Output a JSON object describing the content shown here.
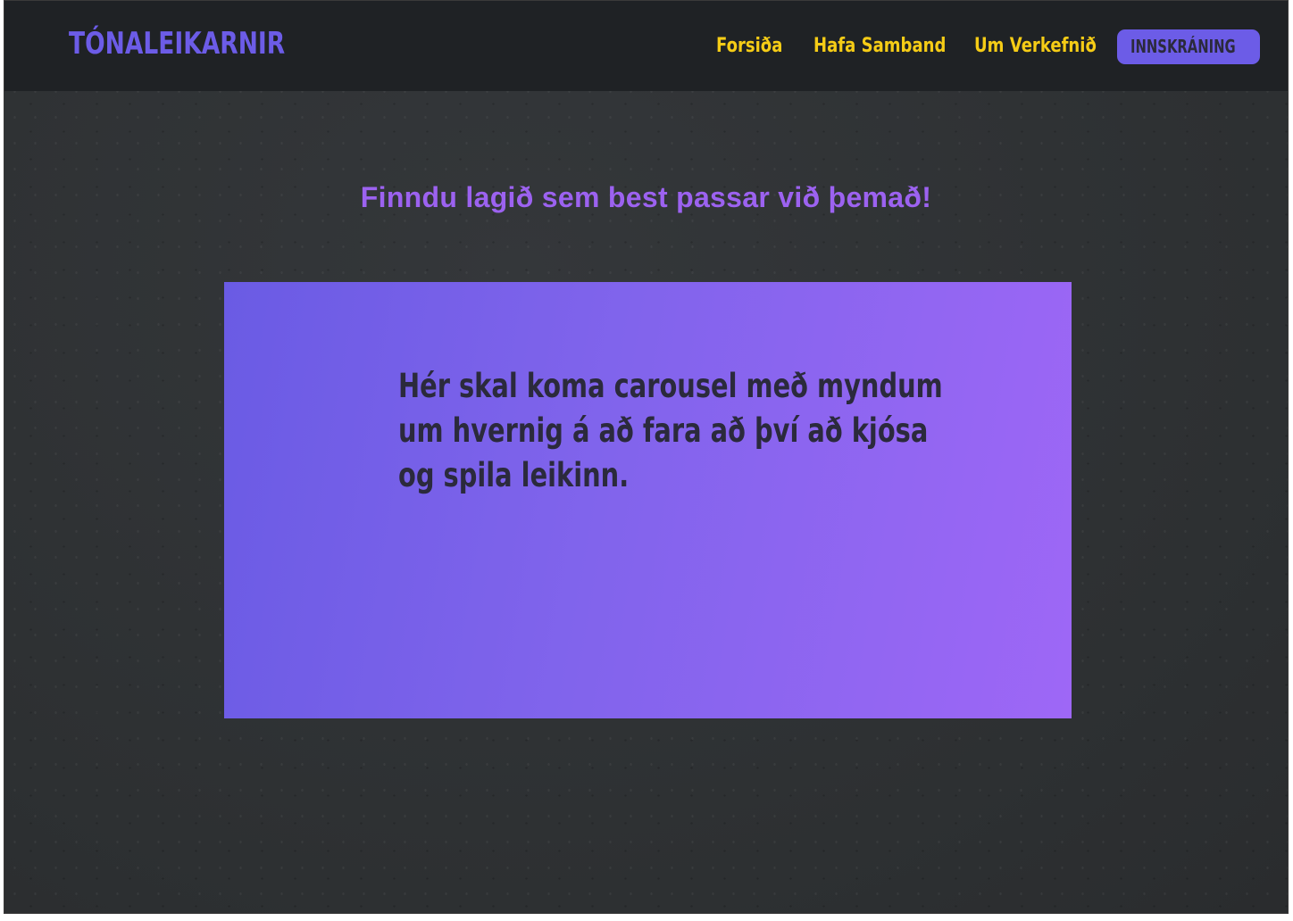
{
  "header": {
    "brand": "TÓNALEIKARNIR",
    "nav": {
      "home": "Forsiða",
      "contact": "Hafa Samband",
      "about": "Um Verkefnið",
      "login": "INNSKRÁNING"
    }
  },
  "main": {
    "headline": "Finndu lagið sem best passar við þemað!",
    "carousel_text": "Hér skal koma carousel með myndum um hvernig á að fara að því að kjósa og spila leikinn."
  },
  "colors": {
    "brand": "#6c5ce7",
    "nav_link": "#f5cc16",
    "headline": "#9c62f0",
    "navbar_bg": "#1f2225",
    "page_bg": "#303335"
  }
}
